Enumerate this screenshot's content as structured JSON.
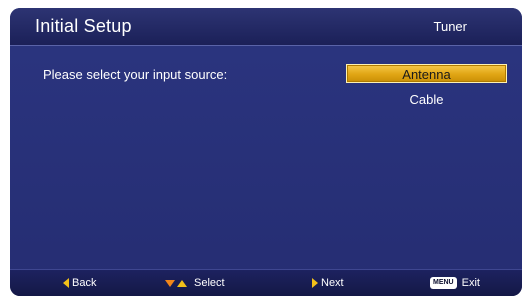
{
  "header": {
    "title": "Initial Setup",
    "section": "Tuner"
  },
  "main": {
    "prompt": "Please select your input source:",
    "options": [
      {
        "label": "Antenna",
        "selected": true
      },
      {
        "label": "Cable",
        "selected": false
      }
    ]
  },
  "footer": {
    "back_label": "Back",
    "select_label": "Select",
    "next_label": "Next",
    "menu_key": "MENU",
    "exit_label": "Exit"
  },
  "colors": {
    "background": "#252d72",
    "highlight": "#e0a514",
    "arrow": "#f2c019"
  }
}
